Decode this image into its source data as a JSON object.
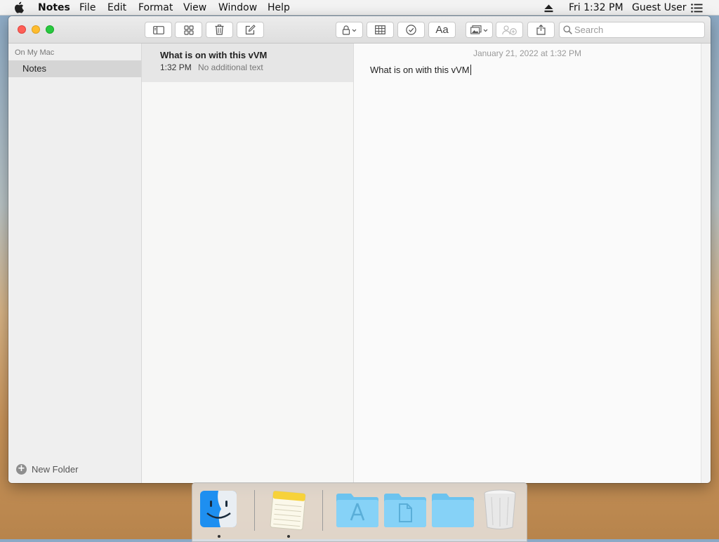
{
  "menubar": {
    "app_name": "Notes",
    "menus": [
      "File",
      "Edit",
      "Format",
      "View",
      "Window",
      "Help"
    ],
    "clock": "Fri 1:32 PM",
    "user": "Guest User",
    "icons": [
      "apple-icon",
      "eject-icon",
      "list-icon"
    ]
  },
  "window": {
    "traffic_lights": {
      "close": "#fe5f57",
      "minimize": "#febc2e",
      "zoom": "#28c840"
    },
    "toolbar": {
      "icons": [
        "sidebar-toggle-icon",
        "gallery-icon",
        "trash-icon",
        "compose-icon",
        "lock-icon",
        "table-icon",
        "checklist-icon",
        "text-style-icon",
        "media-icon",
        "collaborate-icon",
        "share-icon",
        "search-icon"
      ],
      "text_style_label": "Aa",
      "search_placeholder": "Search"
    },
    "sidebar": {
      "section_header": "On My Mac",
      "selected_folder": "Notes",
      "new_folder_label": "New Folder",
      "selection_color": "#d5d5d5"
    },
    "note_list": {
      "notes": [
        {
          "title": "What is on with this vVM",
          "time": "1:32 PM",
          "preview": "No additional text"
        }
      ]
    },
    "editor": {
      "date": "January 21, 2022 at 1:32 PM",
      "body": "What is on with this vVM"
    }
  },
  "dock": {
    "items": [
      "finder-icon",
      "notes-app-icon",
      "applications-folder-icon",
      "documents-folder-icon",
      "downloads-folder-icon",
      "trash-can-icon"
    ],
    "running": [
      "finder-icon",
      "notes-app-icon"
    ]
  }
}
